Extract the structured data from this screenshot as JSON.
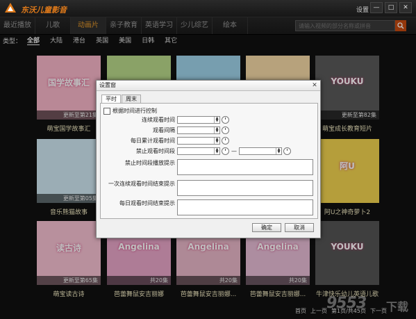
{
  "app": {
    "title": "东沃儿童影音",
    "settings_link": "设置",
    "win_minimize": "—",
    "win_maximize": "□",
    "win_close": "✕"
  },
  "nav": {
    "tabs": [
      "最近播放",
      "儿歌",
      "动画片",
      "亲子教育",
      "英语学习",
      "少儿综艺",
      "绘本"
    ],
    "active_tab": "动画片",
    "search_placeholder": "请输入视频的部分名称或拼音"
  },
  "categories": {
    "label": "类型：",
    "items": [
      "全部",
      "大陆",
      "港台",
      "英国",
      "美国",
      "日韩",
      "其它"
    ],
    "active": "全部"
  },
  "cards": [
    {
      "title": "萌宝国学故事汇",
      "caption": "更新至第21集",
      "color": "#f7b6c8",
      "poster_text": "国学故事汇"
    },
    {
      "title": "",
      "caption": "",
      "color": "#b9d88a",
      "poster_text": ""
    },
    {
      "title": "",
      "caption": "",
      "color": "#9fd3ea",
      "poster_text": ""
    },
    {
      "title": "",
      "caption": "",
      "color": "#f5d9a6",
      "poster_text": ""
    },
    {
      "title": "萌宝成长教育短片",
      "caption": "更新至第82集",
      "color": "#5a5a5a",
      "poster_text": "YOUKU"
    },
    {
      "title": "音乐熊猫故事",
      "caption": "更新至第05集",
      "color": "#cfe7f2",
      "poster_text": ""
    },
    {
      "title": "",
      "caption": "",
      "color": "#d2b48c",
      "poster_text": ""
    },
    {
      "title": "",
      "caption": "",
      "color": "#f4c2d4",
      "poster_text": ""
    },
    {
      "title": "",
      "caption": "",
      "color": "#c9e3a7",
      "poster_text": ""
    },
    {
      "title": "阿U之神奇萝卜2",
      "caption": "",
      "color": "#f2d34f",
      "poster_text": "阿U"
    },
    {
      "title": "萌宝读古诗",
      "caption": "更新至第65集",
      "color": "#f6c0d2",
      "poster_text": "读古诗"
    },
    {
      "title": "芭蕾舞鼠安吉丽娜",
      "caption": "共20集",
      "color": "#e9a6c9",
      "poster_text": "Angelina"
    },
    {
      "title": "芭蕾舞鼠安吉丽娜...",
      "caption": "共20集",
      "color": "#e9b7c8",
      "poster_text": "Angelina"
    },
    {
      "title": "芭蕾舞鼠安吉丽娜...",
      "caption": "共20集",
      "color": "#e7bdd6",
      "poster_text": "Angelina"
    },
    {
      "title": "牛津快乐幼儿英语儿歌",
      "caption": "",
      "color": "#555555",
      "poster_text": "YOUKU"
    }
  ],
  "dialog": {
    "title": "设置窗",
    "close": "✕",
    "tabs": [
      "平时",
      "周末"
    ],
    "active_tab": "平时",
    "control_checkbox": "根据时间进行控制",
    "fields": [
      "连续观看时间",
      "观看间隔",
      "每日累计观看时间",
      "禁止观看时间段"
    ],
    "range_separator": "—",
    "textareas": [
      "禁止时间段播放提示",
      "一次连续观看时间结束提示",
      "每日观看时间结束提示"
    ],
    "ok": "确定",
    "cancel": "取消"
  },
  "footer": {
    "pager": [
      "首页",
      "上一页",
      "第1页/共45页",
      "下一页"
    ]
  },
  "watermark": {
    "text": "9553",
    "sub": "下载"
  },
  "colors": {
    "accent": "#e07a1a",
    "active_nav": "#e89a2a",
    "search_btn": "#c64a0f"
  }
}
